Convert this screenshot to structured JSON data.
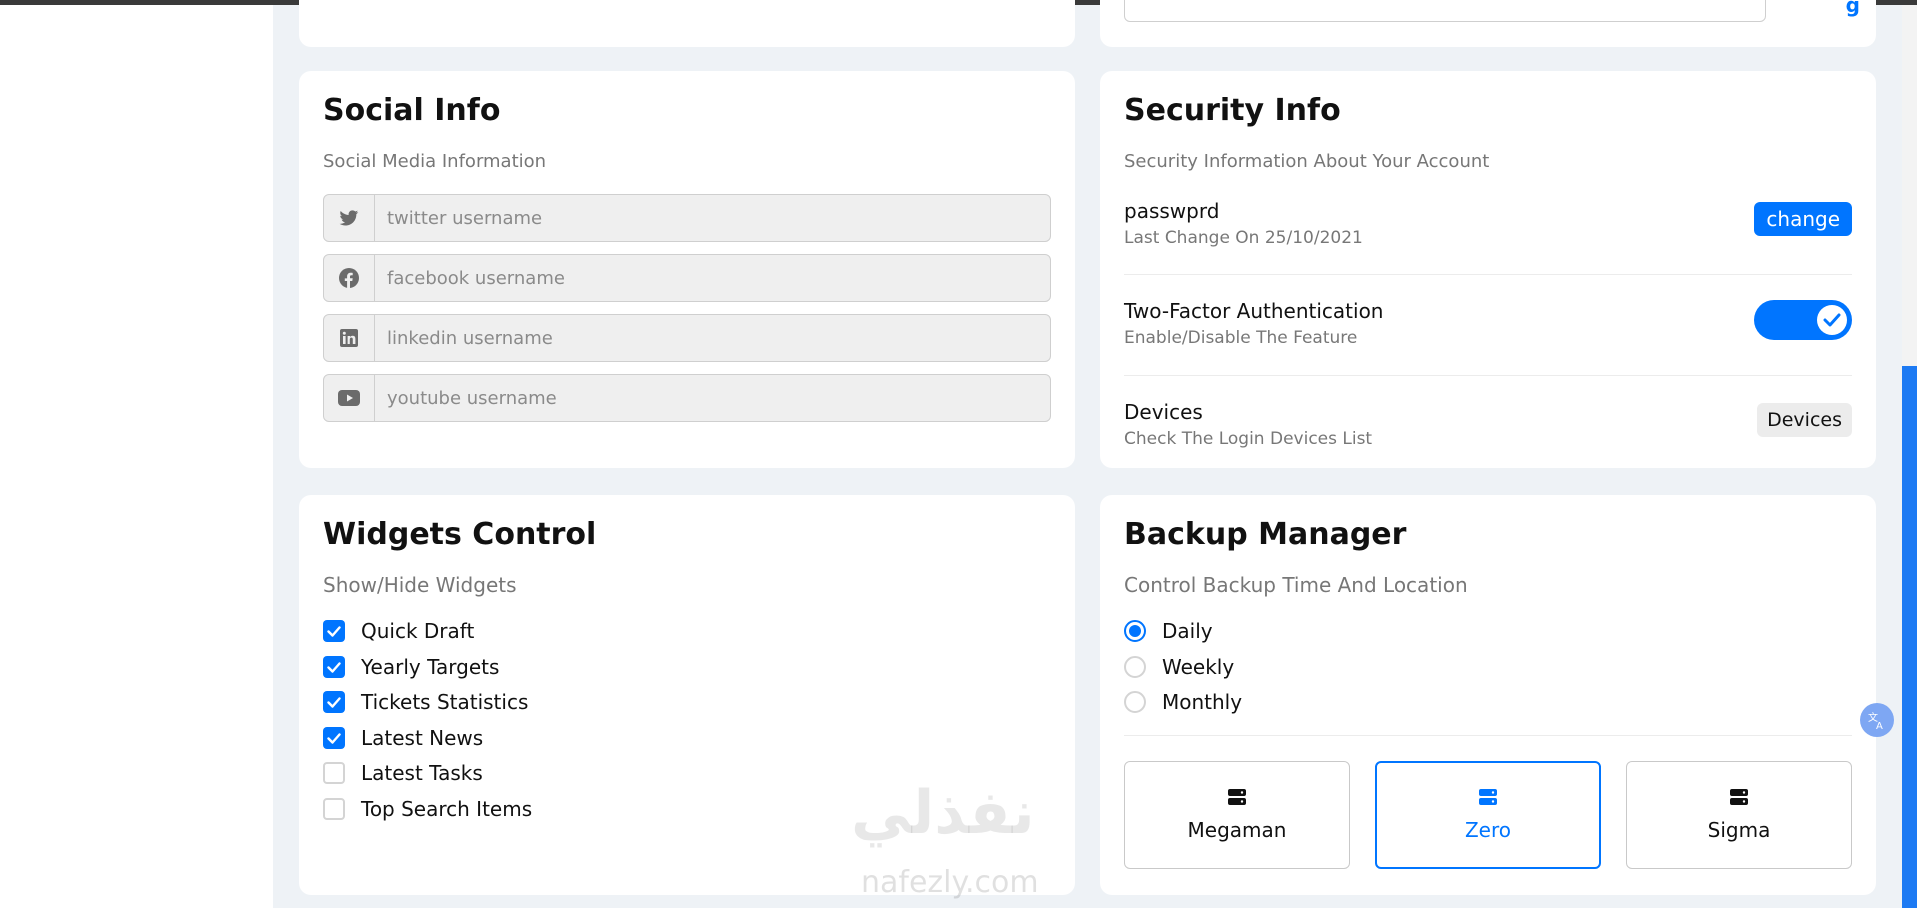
{
  "social": {
    "title": "Social Info",
    "subtitle": "Social Media Information",
    "fields": [
      {
        "icon": "twitter-icon",
        "placeholder": "twitter username"
      },
      {
        "icon": "facebook-icon",
        "placeholder": "facebook username"
      },
      {
        "icon": "linkedin-icon",
        "placeholder": "linkedin username"
      },
      {
        "icon": "youtube-icon",
        "placeholder": "youtube username"
      }
    ]
  },
  "security": {
    "title": "Security Info",
    "subtitle": "Security Information About Your Account",
    "password": {
      "label": "passwprd",
      "desc": "Last Change On 25/10/2021",
      "button": "change"
    },
    "two_factor": {
      "label": "Two-Factor Authentication",
      "desc": "Enable/Disable The Feature",
      "enabled": true
    },
    "devices": {
      "label": "Devices",
      "desc": "Check The Login Devices List",
      "button": "Devices"
    }
  },
  "widgets": {
    "title": "Widgets Control",
    "subtitle": "Show/Hide Widgets",
    "items": [
      {
        "label": "Quick Draft",
        "checked": true
      },
      {
        "label": "Yearly Targets",
        "checked": true
      },
      {
        "label": "Tickets Statistics",
        "checked": true
      },
      {
        "label": "Latest News",
        "checked": true
      },
      {
        "label": "Latest Tasks",
        "checked": false
      },
      {
        "label": "Top Search Items",
        "checked": false
      }
    ]
  },
  "backup": {
    "title": "Backup Manager",
    "subtitle": "Control Backup Time And Location",
    "options": [
      {
        "label": "Daily",
        "selected": true
      },
      {
        "label": "Weekly",
        "selected": false
      },
      {
        "label": "Monthly",
        "selected": false
      }
    ],
    "servers": [
      {
        "name": "Megaman",
        "active": false
      },
      {
        "name": "Zero",
        "active": true
      },
      {
        "name": "Sigma",
        "active": false
      }
    ]
  },
  "watermark": {
    "arabic": "نفذلي",
    "latin": "nafezly.com"
  },
  "colors": {
    "accent": "#0075ff",
    "page_bg": "#eef2f6",
    "card_bg": "#ffffff"
  }
}
